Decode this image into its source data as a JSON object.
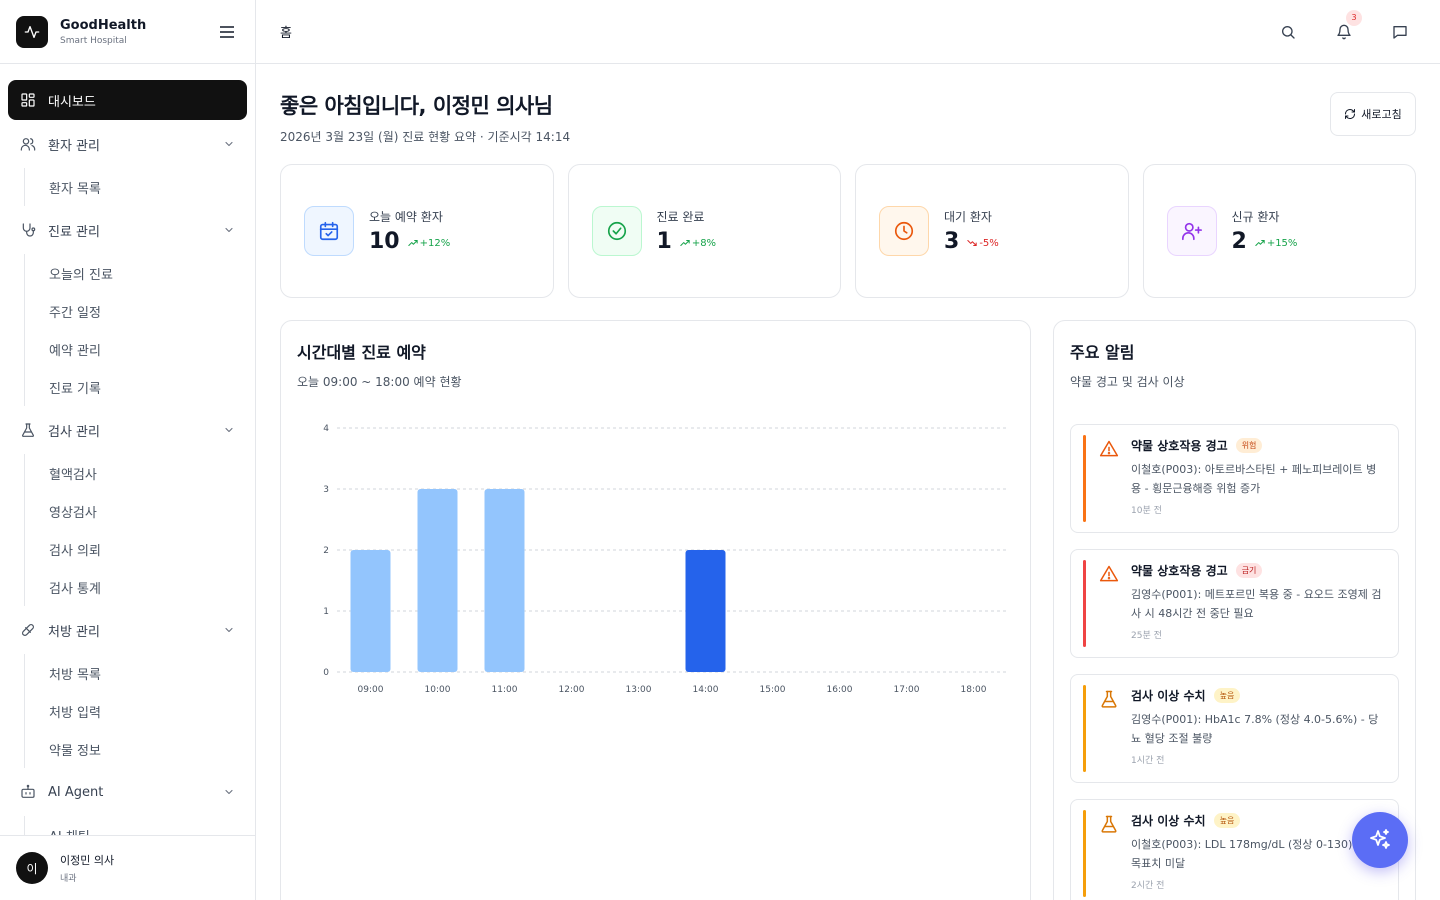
{
  "brand": {
    "name": "GoodHealth",
    "subtitle": "Smart Hospital"
  },
  "sidebar": {
    "items": [
      {
        "label": "대시보드",
        "icon": "dashboard-icon",
        "active": true
      },
      {
        "label": "환자 관리",
        "icon": "users-icon",
        "children": [
          "환자 목록"
        ]
      },
      {
        "label": "진료 관리",
        "icon": "stethoscope-icon",
        "children": [
          "오늘의 진료",
          "주간 일정",
          "예약 관리",
          "진료 기록"
        ]
      },
      {
        "label": "검사 관리",
        "icon": "flask-icon",
        "children": [
          "혈액검사",
          "영상검사",
          "검사 의뢰",
          "검사 통계"
        ]
      },
      {
        "label": "처방 관리",
        "icon": "pill-icon",
        "children": [
          "처방 목록",
          "처방 입력",
          "약물 정보"
        ]
      },
      {
        "label": "AI Agent",
        "icon": "bot-icon",
        "children": [
          "AI 채팅"
        ]
      }
    ]
  },
  "user": {
    "initial": "이",
    "name": "이정민 의사",
    "dept": "내과"
  },
  "topbar": {
    "breadcrumb": "홈",
    "notification_count": "3"
  },
  "header": {
    "title": "좋은 아침입니다, 이정민 의사님",
    "subtitle": "2026년 3월 23일 (월) 진료 현황 요약 · 기준시각 14:14",
    "refresh_label": "새로고침"
  },
  "stats": [
    {
      "label": "오늘 예약 환자",
      "value": "10",
      "trend": "+12%",
      "dir": "up",
      "color": "#2563eb",
      "bg": "#eff6ff",
      "border": "#bfdbfe",
      "icon": "calendar-icon"
    },
    {
      "label": "진료 완료",
      "value": "1",
      "trend": "+8%",
      "dir": "up",
      "color": "#16a34a",
      "bg": "#f0fdf4",
      "border": "#bbf7d0",
      "icon": "check-circle-icon"
    },
    {
      "label": "대기 환자",
      "value": "3",
      "trend": "-5%",
      "dir": "down",
      "color": "#ea580c",
      "bg": "#fff7ed",
      "border": "#fed7aa",
      "icon": "clock-icon"
    },
    {
      "label": "신규 환자",
      "value": "2",
      "trend": "+15%",
      "dir": "up",
      "color": "#9333ea",
      "bg": "#faf5ff",
      "border": "#e9d5ff",
      "icon": "user-plus-icon"
    }
  ],
  "chart": {
    "title": "시간대별 진료 예약",
    "subtitle": "오늘 09:00 ~ 18:00 예약 현황"
  },
  "chart_data": {
    "type": "bar",
    "categories": [
      "09:00",
      "10:00",
      "11:00",
      "12:00",
      "13:00",
      "14:00",
      "15:00",
      "16:00",
      "17:00",
      "18:00"
    ],
    "values": [
      2,
      3,
      3,
      0,
      0,
      2,
      0,
      0,
      0,
      0
    ],
    "highlight_index": 5,
    "ylim": [
      0,
      4
    ],
    "yticks": [
      "0",
      "1",
      "2",
      "3",
      "4"
    ],
    "grid": true,
    "colors": {
      "bar": "#93c5fd",
      "highlight": "#2563eb"
    }
  },
  "alerts": {
    "title": "주요 알림",
    "subtitle": "약물 경고 및 검사 이상",
    "items": [
      {
        "title": "약물 상호작용 경고",
        "tag": "위험",
        "desc": "이철호(P003): 아토르바스타틴 + 페노피브레이트 병용 - 횡문근융해증 위험 증가",
        "time": "10분 전",
        "bar": "#f97316",
        "icon": "warning-icon",
        "iconColor": "#ea580c",
        "tagBg": "#ffedd5",
        "tagColor": "#c2410c"
      },
      {
        "title": "약물 상호작용 경고",
        "tag": "금기",
        "desc": "김영수(P001): 메트포르민 복용 중 - 요오드 조영제 검사 시 48시간 전 중단 필요",
        "time": "25분 전",
        "bar": "#ef4444",
        "icon": "warning-icon",
        "iconColor": "#ea580c",
        "tagBg": "#fee2e2",
        "tagColor": "#b91c1c"
      },
      {
        "title": "검사 이상 수치",
        "tag": "높음",
        "desc": "김영수(P001): HbA1c 7.8% (정상 4.0-5.6%) - 당뇨 혈당 조절 불량",
        "time": "1시간 전",
        "bar": "#f59e0b",
        "icon": "flask-icon",
        "iconColor": "#d97706",
        "tagBg": "#fef3c7",
        "tagColor": "#b45309"
      },
      {
        "title": "검사 이상 수치",
        "tag": "높음",
        "desc": "이철호(P003): LDL 178mg/dL (정상 0-130) - 증 목표치 미달",
        "time": "2시간 전",
        "bar": "#f59e0b",
        "icon": "flask-icon",
        "iconColor": "#d97706",
        "tagBg": "#fef3c7",
        "tagColor": "#b45309"
      }
    ]
  }
}
